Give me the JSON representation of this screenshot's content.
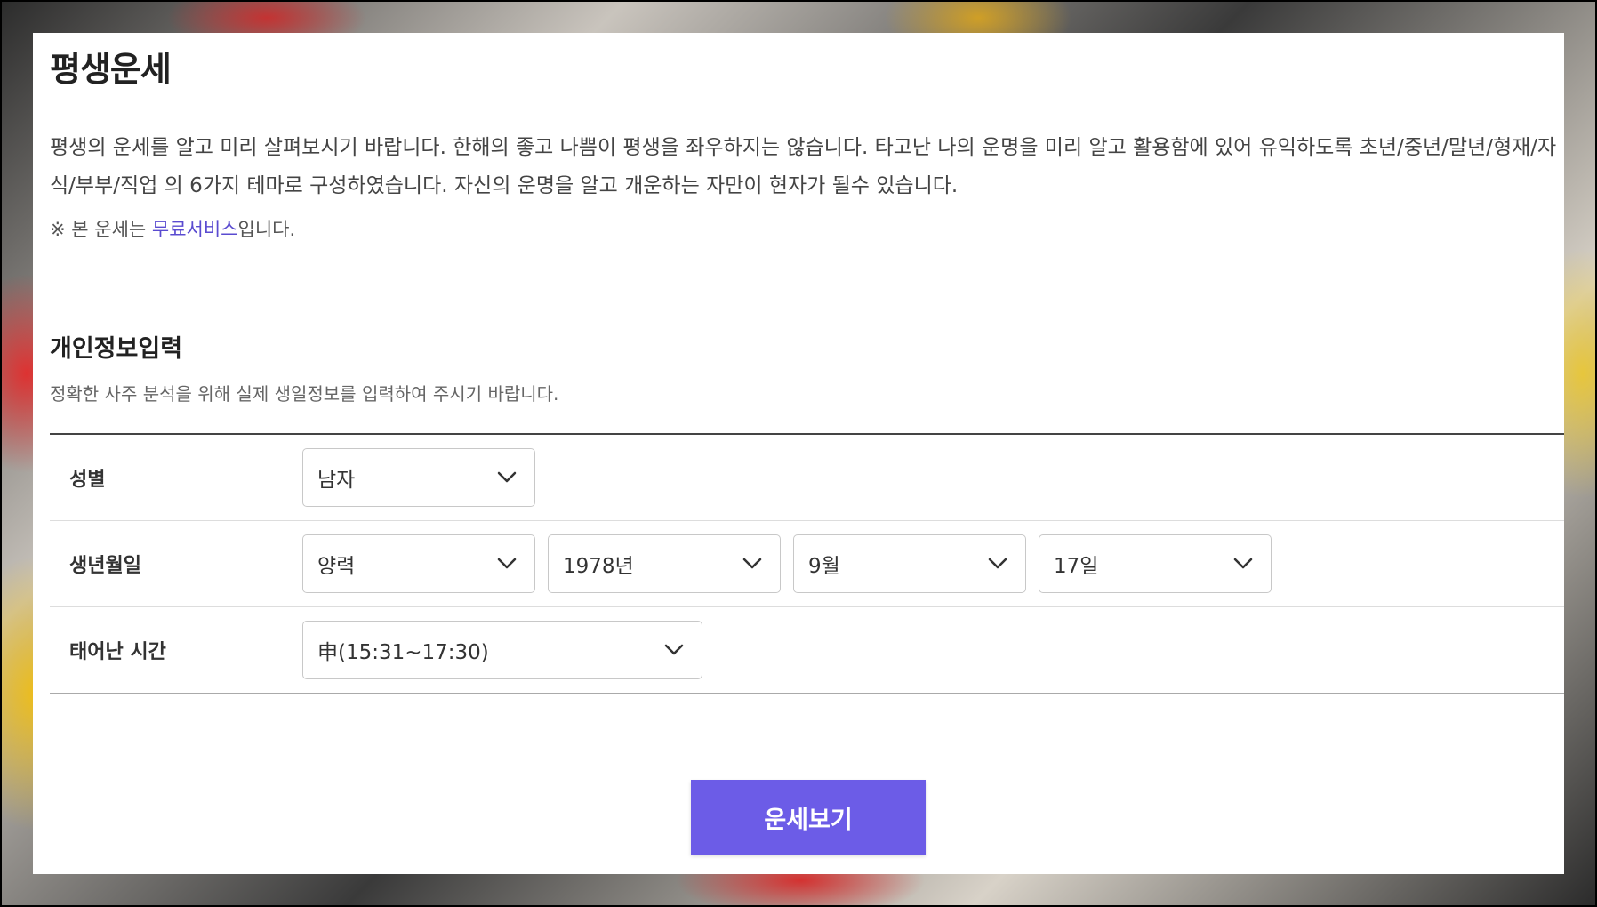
{
  "page": {
    "title": "평생운세",
    "intro": "평생의 운세를 알고 미리 살펴보시기 바랍니다. 한해의 좋고 나쁨이 평생을 좌우하지는 않습니다. 타고난 나의 운명을 미리 알고 활용함에 있어 유익하도록 초년/중년/말년/형재/자식/부부/직업 의 6가지 테마로 구성하였습니다. 자신의 운명을 알고 개운하는 자만이 현자가 될수 있습니다.",
    "note_prefix": "※ 본 운세는 ",
    "note_link": "무료서비스",
    "note_suffix": "입니다."
  },
  "form": {
    "section_title": "개인정보입력",
    "section_desc": "정확한 사주 분석을 위해 실제 생일정보를 입력하여 주시기 바랍니다.",
    "gender": {
      "label": "성별",
      "value": "남자"
    },
    "birthdate": {
      "label": "생년월일",
      "calendar": "양력",
      "year": "1978년",
      "month": "9월",
      "day": "17일"
    },
    "birthtime": {
      "label": "태어난 시간",
      "value": "申(15:31~17:30)"
    },
    "submit_label": "운세보기"
  },
  "icons": {
    "dropdown": "chevron-down-icon"
  },
  "colors": {
    "accent": "#6c5ce7",
    "link": "#5a4bd0"
  }
}
